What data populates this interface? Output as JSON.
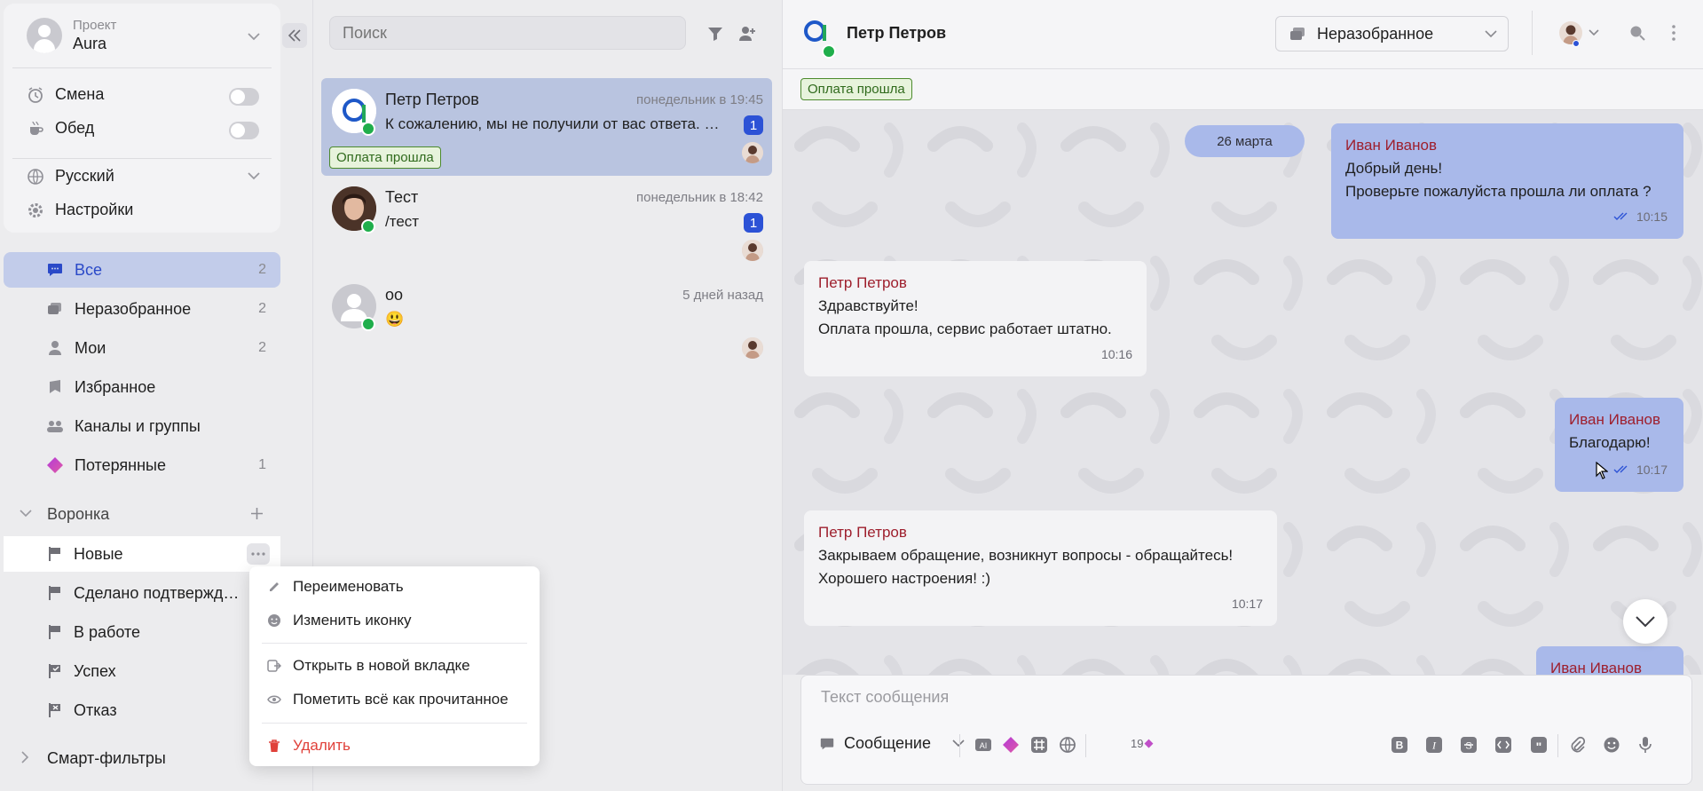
{
  "project": {
    "label": "Проект",
    "name": "Aura"
  },
  "toggles": [
    {
      "label": "Смена",
      "on": false
    },
    {
      "label": "Обед",
      "on": false
    }
  ],
  "settings": {
    "language": "Русский",
    "settings_label": "Настройки"
  },
  "nav": [
    {
      "label": "Все",
      "count": "2",
      "icon": "chat-bubble-icon",
      "active": true
    },
    {
      "label": "Неразобранное",
      "count": "2",
      "icon": "inbox-stack-icon"
    },
    {
      "label": "Мои",
      "count": "2",
      "icon": "user-icon"
    },
    {
      "label": "Избранное",
      "count": "",
      "icon": "bookmark-icon"
    },
    {
      "label": "Каналы и группы",
      "count": "",
      "icon": "group-icon"
    },
    {
      "label": "Потерянные",
      "count": "1",
      "icon": "diamond-icon"
    }
  ],
  "funnel": {
    "title": "Воронка",
    "items": [
      {
        "label": "Новые",
        "icon": "flag-icon"
      },
      {
        "label": "Сделано подтверждение",
        "icon": "flag-icon"
      },
      {
        "label": "В работе",
        "icon": "flag-icon"
      },
      {
        "label": "Успех",
        "icon": "flag-check-icon"
      },
      {
        "label": "Отказ",
        "icon": "flag-x-icon"
      }
    ]
  },
  "smart_filters": {
    "label": "Смарт-фильтры"
  },
  "context_menu": [
    {
      "label": "Переименовать",
      "icon": "pencil-icon"
    },
    {
      "label": "Изменить иконку",
      "icon": "smile-icon"
    },
    {
      "label": "Открыть в новой вкладке",
      "icon": "open-tab-icon"
    },
    {
      "label": "Пометить всё как прочитанное",
      "icon": "eye-icon"
    },
    {
      "label": "Удалить",
      "icon": "trash-icon"
    }
  ],
  "search": {
    "placeholder": "Поиск"
  },
  "chats": [
    {
      "name": "Петр Петров",
      "time": "понедельник в 19:45",
      "preview": "К сожалению, мы не получили от вас ответа. Мы закрываем обращение",
      "unread": "1",
      "tag": "Оплата прошла",
      "selected": true
    },
    {
      "name": "Тест",
      "time": "понедельник в 18:42",
      "preview": "/тест",
      "unread": "1"
    },
    {
      "name": "оо",
      "time": "5 дней назад",
      "preview": "😃",
      "unread": ""
    }
  ],
  "conversation": {
    "contact_name": "Петр Петров",
    "status": "Неразобранное",
    "tag": "Оплата прошла",
    "date_chip": "26 марта",
    "messages": [
      {
        "author": "Иван Иванов",
        "lines": [
          "Добрый день!",
          "Проверьте пожалуйста прошла ли оплата ?"
        ],
        "time": "10:15",
        "direction": "out"
      },
      {
        "author": "Петр Петров",
        "lines": [
          "Здравствуйте!",
          "Оплата прошла, сервис работает штатно."
        ],
        "time": "10:16",
        "direction": "in"
      },
      {
        "author": "Иван Иванов",
        "lines": [
          "Благодарю!"
        ],
        "time": "10:17",
        "direction": "out"
      },
      {
        "author": "Петр Петров",
        "lines": [
          "Закрываем обращение, возникнут вопросы - обращайтесь!",
          "Хорошего настроения! :)"
        ],
        "time": "10:17",
        "direction": "in"
      },
      {
        "author": "Иван Иванов",
        "lines": [],
        "time": "",
        "direction": "out"
      }
    ]
  },
  "composer": {
    "placeholder": "Текст сообщения",
    "mode": "Сообщение",
    "counter": "19"
  },
  "colors": {
    "accent": "#2c52d6",
    "bubble_out": "#a9b9ea",
    "author": "#9e1f2d",
    "tag_green": "#4c8a2d",
    "danger": "#e0413a"
  }
}
